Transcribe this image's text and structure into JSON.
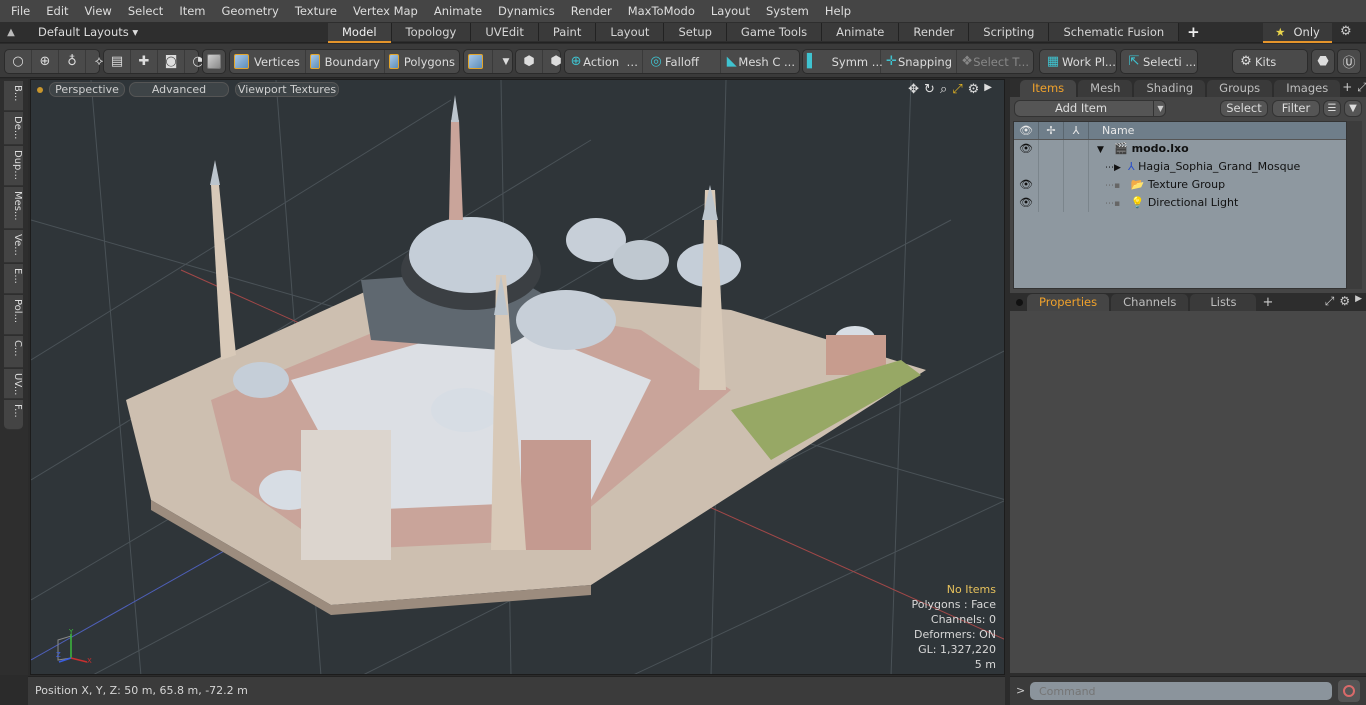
{
  "menubar": {
    "items": [
      "File",
      "Edit",
      "View",
      "Select",
      "Item",
      "Geometry",
      "Texture",
      "Vertex Map",
      "Animate",
      "Dynamics",
      "Render",
      "MaxToModo",
      "Layout",
      "System",
      "Help"
    ]
  },
  "layoutbar": {
    "layout_select": "Default Layouts",
    "tabs": [
      "Model",
      "Topology",
      "UVEdit",
      "Paint",
      "Layout",
      "Setup",
      "Game Tools",
      "Animate",
      "Render",
      "Scripting",
      "Schematic Fusion"
    ],
    "active_tab": "Model",
    "only_label": "Only"
  },
  "toolbar": {
    "vertices": "Vertices",
    "boundary": "Boundary",
    "polygons": "Polygons",
    "action": "Action",
    "falloff": "Falloff",
    "mesh_c": "Mesh C ...",
    "symm": "Symm ...",
    "snapping": "Snapping",
    "select_t": "Select T...",
    "work_pl": "Work Pl...",
    "selecti": "Selecti ...",
    "kits": "Kits"
  },
  "left_tools": [
    "B...",
    "De...",
    "Dup...",
    "Mes...",
    "Ve...",
    "E...",
    "Pol...",
    "C...",
    "UV...",
    "F..."
  ],
  "viewport": {
    "view_mode": "Perspective",
    "advanced": "Advanced",
    "textures": "Viewport Textures",
    "info": {
      "selection": "No Items",
      "polygons": "Polygons : Face",
      "channels": "Channels: 0",
      "deformers": "Deformers: ON",
      "gl": "GL: 1,327,220",
      "scale": "5 m"
    }
  },
  "status": {
    "position": "Position X, Y, Z:   50 m, 65.8 m, -72.2 m"
  },
  "items_panel": {
    "tabs": [
      "Items",
      "Mesh ...",
      "Shading",
      "Groups",
      "Images"
    ],
    "active_tab": "Items",
    "add_item": "Add Item",
    "select": "Select",
    "filter": "Filter",
    "column_name": "Name",
    "tree": [
      {
        "name": "modo.lxo",
        "visible": true,
        "level": 0,
        "bold": true
      },
      {
        "name": "Hagia_Sophia_Grand_Mosque",
        "visible": false,
        "level": 1,
        "bold": false
      },
      {
        "name": "Texture Group",
        "visible": true,
        "level": 1,
        "bold": false
      },
      {
        "name": "Directional Light",
        "visible": true,
        "level": 1,
        "bold": false
      }
    ]
  },
  "properties_panel": {
    "tabs": [
      "Properties",
      "Channels",
      "Lists"
    ],
    "active_tab": "Properties"
  },
  "command": {
    "placeholder": "Command"
  },
  "colors": {
    "accent": "#e5952b",
    "active_tab_text": "#f0a22c",
    "info_warn": "#e6c15c"
  }
}
